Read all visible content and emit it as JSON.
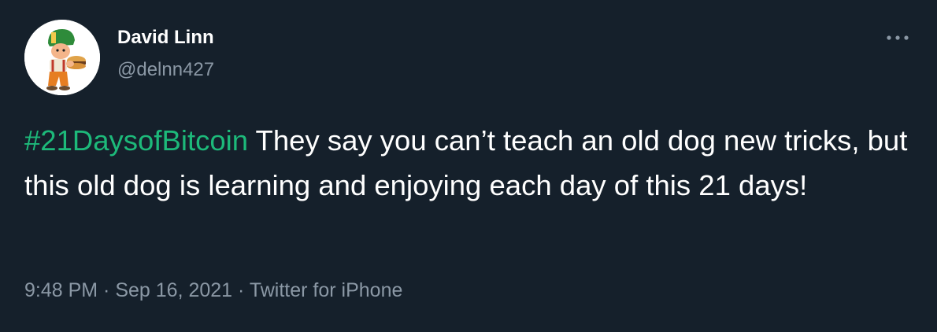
{
  "author": {
    "display_name": "David Linn",
    "handle": "@delnn427",
    "avatar": "cartoon-character-holding-burger"
  },
  "tweet": {
    "hashtag": "#21DaysofBitcoin",
    "text": " They say you can’t teach an old dog new tricks, but this old dog is learning and enjoying each day of this 21 days!"
  },
  "meta": {
    "time": "9:48 PM",
    "separator": " · ",
    "date": "Sep 16, 2021",
    "source": "Twitter for iPhone"
  },
  "more_icon": "more-horizontal-icon",
  "colors": {
    "background": "#15202b",
    "text": "#ffffff",
    "secondary": "#8b98a5",
    "hashtag": "#1db97a"
  }
}
